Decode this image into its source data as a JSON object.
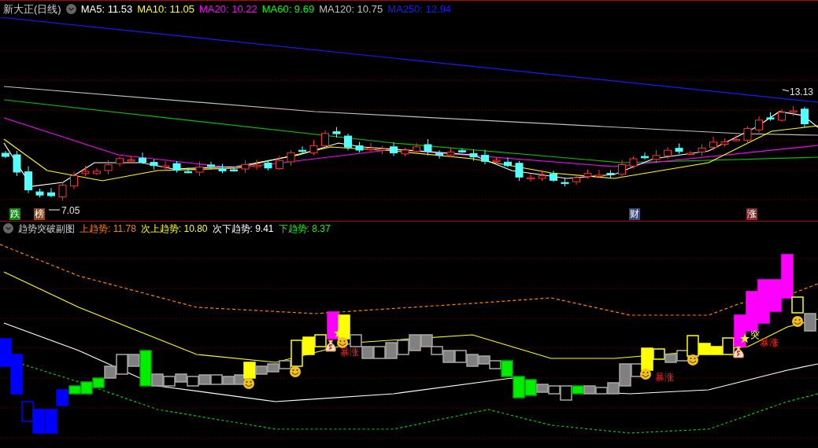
{
  "main_panel": {
    "title": "新大正(日线)",
    "indicators": [
      {
        "text": "MA5: 11.53",
        "color": "#ffffff"
      },
      {
        "text": "MA10: 11.05",
        "color": "#ffff00"
      },
      {
        "text": "MA20: 10.22",
        "color": "#ff00ff"
      },
      {
        "text": "MA60: 9.69",
        "color": "#00ff00"
      },
      {
        "text": "MA120: 10.75",
        "color": "#c0c0c0"
      },
      {
        "text": "MA250: 12.94",
        "color": "#1a1aff"
      }
    ],
    "price_labels": [
      {
        "text": "13.13"
      },
      {
        "text": "7.05"
      }
    ],
    "event_tags": [
      {
        "text": "跌",
        "color": "#108a10"
      },
      {
        "text": "榜",
        "color": "#8a4a1a"
      },
      {
        "text": "财",
        "color": "#3a4a7a"
      },
      {
        "text": "涨",
        "color": "#8a2a2a"
      }
    ]
  },
  "sub_panel": {
    "title": "趋势突破副图",
    "indicators": [
      {
        "text": "上趋势: 11.78",
        "color": "#ff8000"
      },
      {
        "text": "次上趋势: 10.80",
        "color": "#ffff00"
      },
      {
        "text": "次下趋势: 9.41",
        "color": "#ffffff"
      },
      {
        "text": "下趋势: 8.37",
        "color": "#00ff00"
      }
    ],
    "breakout_label": "突",
    "surge_labels": [
      "暴涨",
      "暴涨",
      "暴涨"
    ]
  }
}
